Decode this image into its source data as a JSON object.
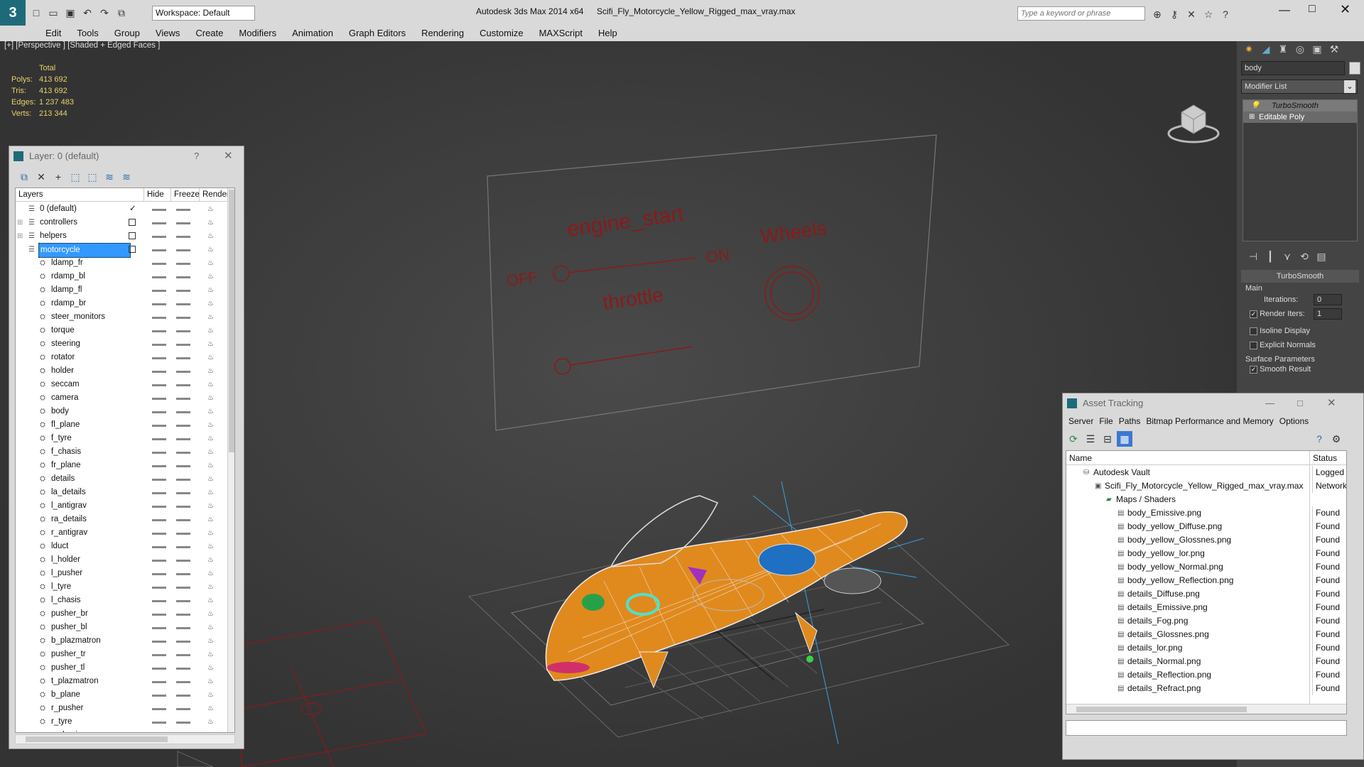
{
  "titlebar": {
    "workspace_label": "Workspace: Default",
    "app_title": "Autodesk 3ds Max  2014 x64",
    "file_title": "Scifi_Fly_Motorcycle_Yellow_Rigged_max_vray.max",
    "search_placeholder": "Type a keyword or phrase"
  },
  "menu": [
    "Edit",
    "Tools",
    "Group",
    "Views",
    "Create",
    "Modifiers",
    "Animation",
    "Graph Editors",
    "Rendering",
    "Customize",
    "MAXScript",
    "Help"
  ],
  "viewport": {
    "label": "[+] [Perspective ] [Shaded + Edged Faces ]",
    "stats": {
      "total_label": "Total",
      "polys_label": "Polys:",
      "polys": "413 692",
      "tris_label": "Tris:",
      "tris": "413 692",
      "edges_label": "Edges:",
      "edges": "1 237 483",
      "verts_label": "Verts:",
      "verts": "213 344"
    },
    "board": {
      "engine_start": "engine_start",
      "wheels": "Wheels",
      "off": "OFF",
      "on": "ON",
      "throttle": "throttle"
    }
  },
  "command_panel": {
    "object_name": "body",
    "modifier_list_label": "Modifier List",
    "stack": [
      "TurboSmooth",
      "Editable Poly"
    ],
    "turbosmooth": {
      "rollout_title": "TurboSmooth",
      "main_label": "Main",
      "iterations_label": "Iterations:",
      "iterations_value": "0",
      "render_iters_label": "Render Iters:",
      "render_iters_value": "1",
      "isoline_label": "Isoline Display",
      "explicit_normals_label": "Explicit Normals",
      "surface_params_label": "Surface Parameters",
      "smooth_result_label": "Smooth Result"
    }
  },
  "layer_window": {
    "title": "Layer: 0 (default)",
    "help": "?",
    "col_layers": "Layers",
    "col_hide": "Hide",
    "col_freeze": "Freeze",
    "col_render": "Render",
    "layers": [
      {
        "name": "0 (default)",
        "indent": 0,
        "checked": true
      },
      {
        "name": "controllers",
        "indent": 0,
        "expand": true
      },
      {
        "name": "helpers",
        "indent": 0,
        "expand": true
      },
      {
        "name": "motorcycle",
        "indent": 0,
        "selected": true
      }
    ],
    "objects": [
      "ldamp_fr",
      "rdamp_bl",
      "ldamp_fl",
      "rdamp_br",
      "steer_monitors",
      "torque",
      "steering",
      "rotator",
      "holder",
      "seccam",
      "camera",
      "body",
      "fl_plane",
      "f_tyre",
      "f_chasis",
      "fr_plane",
      "details",
      "la_details",
      "l_antigrav",
      "ra_details",
      "r_antigrav",
      "lduct",
      "l_holder",
      "l_pusher",
      "l_tyre",
      "l_chasis",
      "pusher_br",
      "pusher_bl",
      "b_plazmatron",
      "pusher_tr",
      "pusher_tl",
      "t_plazmatron",
      "b_plane",
      "r_pusher",
      "r_tyre",
      "r_chasis"
    ]
  },
  "asset_window": {
    "title": "Asset Tracking",
    "menu": [
      "Server",
      "File",
      "Paths",
      "Bitmap Performance and Memory",
      "Options"
    ],
    "col_name": "Name",
    "col_status": "Status",
    "rows": [
      {
        "name": "Autodesk Vault",
        "status": "Logged (",
        "level": 1
      },
      {
        "name": "Scifi_Fly_Motorcycle_Yellow_Rigged_max_vray.max",
        "status": "Network",
        "level": 2
      },
      {
        "name": "Maps / Shaders",
        "status": "",
        "level": 3
      },
      {
        "name": "body_Emissive.png",
        "status": "Found",
        "level": 4
      },
      {
        "name": "body_yellow_Diffuse.png",
        "status": "Found",
        "level": 4
      },
      {
        "name": "body_yellow_Glossnes.png",
        "status": "Found",
        "level": 4
      },
      {
        "name": "body_yellow_lor.png",
        "status": "Found",
        "level": 4
      },
      {
        "name": "body_yellow_Normal.png",
        "status": "Found",
        "level": 4
      },
      {
        "name": "body_yellow_Reflection.png",
        "status": "Found",
        "level": 4
      },
      {
        "name": "details_Diffuse.png",
        "status": "Found",
        "level": 4
      },
      {
        "name": "details_Emissive.png",
        "status": "Found",
        "level": 4
      },
      {
        "name": "details_Fog.png",
        "status": "Found",
        "level": 4
      },
      {
        "name": "details_Glossnes.png",
        "status": "Found",
        "level": 4
      },
      {
        "name": "details_lor.png",
        "status": "Found",
        "level": 4
      },
      {
        "name": "details_Normal.png",
        "status": "Found",
        "level": 4
      },
      {
        "name": "details_Reflection.png",
        "status": "Found",
        "level": 4
      },
      {
        "name": "details_Refract.png",
        "status": "Found",
        "level": 4
      }
    ]
  },
  "colors": {
    "accent_blue": "#3399ff",
    "stats_yellow": "#e8d06a",
    "board_red": "#8a1a1a",
    "bike_orange": "#e08a1e"
  }
}
